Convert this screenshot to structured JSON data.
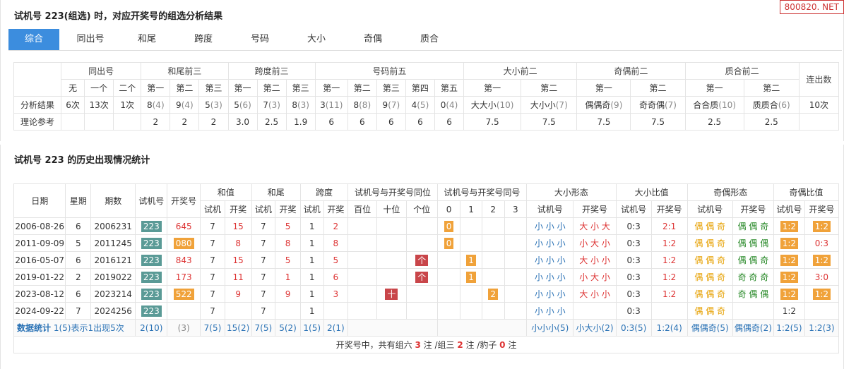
{
  "watermark": "800820. NET",
  "title1": "试机号 223(组选) 时，对应开奖号的组选分析结果",
  "tabs": [
    "综合",
    "同出号",
    "和尾",
    "跨度",
    "号码",
    "大小",
    "奇偶",
    "质合"
  ],
  "t1": {
    "groups": [
      "同出号",
      "和尾前三",
      "跨度前三",
      "号码前五",
      "大小前二",
      "奇偶前二",
      "质合前二",
      "连出数"
    ],
    "sub": [
      "无",
      "一个",
      "二个",
      "第一",
      "第二",
      "第三",
      "第一",
      "第二",
      "第三",
      "第一",
      "第二",
      "第三",
      "第四",
      "第五",
      "第一",
      "第二",
      "第一",
      "第二",
      "第一",
      "第二"
    ],
    "row1_label": "分析结果",
    "row1": [
      [
        "6次",
        ""
      ],
      [
        "13次",
        ""
      ],
      [
        "1次",
        ""
      ],
      [
        "8",
        "(4)"
      ],
      [
        "9",
        "(4)"
      ],
      [
        "5",
        "(3)"
      ],
      [
        "5",
        "(6)"
      ],
      [
        "7",
        "(3)"
      ],
      [
        "8",
        "(3)"
      ],
      [
        "3",
        "(11)"
      ],
      [
        "8",
        "(8)"
      ],
      [
        "9",
        "(7)"
      ],
      [
        "4",
        "(5)"
      ],
      [
        "0",
        "(4)"
      ],
      [
        "大大小",
        "(10)"
      ],
      [
        "大小小",
        "(7)"
      ],
      [
        "偶偶奇",
        "(9)"
      ],
      [
        "奇奇偶",
        "(7)"
      ],
      [
        "合合质",
        "(10)"
      ],
      [
        "质质合",
        "(6)"
      ],
      [
        "10次",
        ""
      ]
    ],
    "row2_label": "理论参考",
    "row2": [
      "",
      "",
      "",
      "2",
      "2",
      "2",
      "3.0",
      "2.5",
      "1.9",
      "6",
      "6",
      "6",
      "6",
      "6",
      "7.5",
      "7.5",
      "7.5",
      "7.5",
      "2.5",
      "2.5",
      ""
    ]
  },
  "title2": "试机号 223 的历史出现情况统计",
  "t2": {
    "h_date": "日期",
    "h_week": "星期",
    "h_issue": "期数",
    "h_sj": "试机号",
    "h_kj": "开奖号",
    "g_sum": "和值",
    "g_tail": "和尾",
    "g_span": "跨度",
    "g_pos": "试机号与开奖号同位",
    "g_same": "试机号与开奖号同号",
    "g_dx": "大小形态",
    "g_dxb": "大小比值",
    "g_jo": "奇偶形态",
    "g_job": "奇偶比值",
    "s_sj": "试机",
    "s_kj": "开奖",
    "s_bai": "百位",
    "s_shi": "十位",
    "s_ge": "个位",
    "s_0": "0",
    "s_1": "1",
    "s_2": "2",
    "s_3": "3",
    "s_sjh": "试机号",
    "s_kjh": "开奖号",
    "rows": [
      {
        "date": "2006-08-26",
        "week": "6",
        "issue": "2006231",
        "sj": "223",
        "kj": "645",
        "kjtag": false,
        "sum_sj": "7",
        "sum_kj": "15",
        "tail_sj": "7",
        "tail_kj": "5",
        "span_sj": "1",
        "span_kj": "2",
        "pos": [
          "",
          "",
          ""
        ],
        "same": [
          "0",
          "",
          "",
          ""
        ],
        "dx_sj": "小 小 小",
        "dx_kj": "大 小 大",
        "dxb_sj": "0:3",
        "dxb_kj": "2:1",
        "jo_sj": "偶 偶 奇",
        "jo_kj": "偶 偶 奇",
        "job_sj": "1:2",
        "job_kj": "1:2",
        "job_kj_tag": true
      },
      {
        "date": "2011-09-09",
        "week": "5",
        "issue": "2011245",
        "sj": "223",
        "kj": "080",
        "kjtag": true,
        "sum_sj": "7",
        "sum_kj": "8",
        "tail_sj": "7",
        "tail_kj": "8",
        "span_sj": "1",
        "span_kj": "8",
        "pos": [
          "",
          "",
          ""
        ],
        "same": [
          "0",
          "",
          "",
          ""
        ],
        "dx_sj": "小 小 小",
        "dx_kj": "小 大 小",
        "dxb_sj": "0:3",
        "dxb_kj": "1:2",
        "jo_sj": "偶 偶 奇",
        "jo_kj": "偶 偶 偶",
        "job_sj": "1:2",
        "job_kj": "0:3",
        "job_kj_tag": false
      },
      {
        "date": "2016-05-07",
        "week": "6",
        "issue": "2016121",
        "sj": "223",
        "kj": "843",
        "kjtag": false,
        "sum_sj": "7",
        "sum_kj": "15",
        "tail_sj": "7",
        "tail_kj": "5",
        "span_sj": "1",
        "span_kj": "5",
        "pos": [
          "",
          "",
          "个"
        ],
        "same": [
          "",
          "1",
          "",
          ""
        ],
        "dx_sj": "小 小 小",
        "dx_kj": "大 小 小",
        "dxb_sj": "0:3",
        "dxb_kj": "1:2",
        "jo_sj": "偶 偶 奇",
        "jo_kj": "偶 偶 奇",
        "job_sj": "1:2",
        "job_kj": "1:2",
        "job_kj_tag": true
      },
      {
        "date": "2019-01-22",
        "week": "2",
        "issue": "2019022",
        "sj": "223",
        "kj": "173",
        "kjtag": false,
        "sum_sj": "7",
        "sum_kj": "11",
        "tail_sj": "7",
        "tail_kj": "1",
        "span_sj": "1",
        "span_kj": "6",
        "pos": [
          "",
          "",
          "个"
        ],
        "same": [
          "",
          "1",
          "",
          ""
        ],
        "dx_sj": "小 小 小",
        "dx_kj": "小 大 小",
        "dxb_sj": "0:3",
        "dxb_kj": "1:2",
        "jo_sj": "偶 偶 奇",
        "jo_kj": "奇 奇 奇",
        "job_sj": "1:2",
        "job_kj": "3:0",
        "job_kj_tag": false
      },
      {
        "date": "2023-08-12",
        "week": "6",
        "issue": "2023214",
        "sj": "223",
        "kj": "522",
        "kjtag": true,
        "sum_sj": "7",
        "sum_kj": "9",
        "tail_sj": "7",
        "tail_kj": "9",
        "span_sj": "1",
        "span_kj": "3",
        "pos": [
          "",
          "十",
          ""
        ],
        "same": [
          "",
          "",
          "2",
          ""
        ],
        "dx_sj": "小 小 小",
        "dx_kj": "大 小 小",
        "dxb_sj": "0:3",
        "dxb_kj": "1:2",
        "jo_sj": "偶 偶 奇",
        "jo_kj": "奇 偶 偶",
        "job_sj": "1:2",
        "job_kj": "1:2",
        "job_kj_tag": true
      },
      {
        "date": "2024-09-22",
        "week": "7",
        "issue": "2024256",
        "sj": "223",
        "kj": "",
        "kjtag": false,
        "sum_sj": "7",
        "sum_kj": "",
        "tail_sj": "7",
        "tail_kj": "",
        "span_sj": "1",
        "span_kj": "",
        "pos": [
          "",
          "",
          ""
        ],
        "same": [
          "",
          "",
          "",
          ""
        ],
        "dx_sj": "小 小 小",
        "dx_kj": "",
        "dxb_sj": "0:3",
        "dxb_kj": "",
        "jo_sj": "偶 偶 奇",
        "jo_kj": "",
        "job_sj": "1:2",
        "job_kj": "",
        "job_kj_tag": false
      }
    ],
    "stat_label": "数据统计",
    "stat_note": "1(5)表示1出现5次",
    "stat": [
      "2(10)",
      "(3)",
      "7(5)",
      "15(2)",
      "7(5)",
      "5(2)",
      "1(5)",
      "2(1)",
      "小小小(5)",
      "小大小(2)",
      "0:3(5)",
      "1:2(4)",
      "偶偶奇(5)",
      "偶偶奇(2)",
      "1:2(5)",
      "1:2(3)"
    ],
    "footer": [
      "开奖号中，共有组六 ",
      "3",
      " 注 /组三 ",
      "2",
      " 注 /豹子 ",
      "0",
      " 注"
    ]
  }
}
